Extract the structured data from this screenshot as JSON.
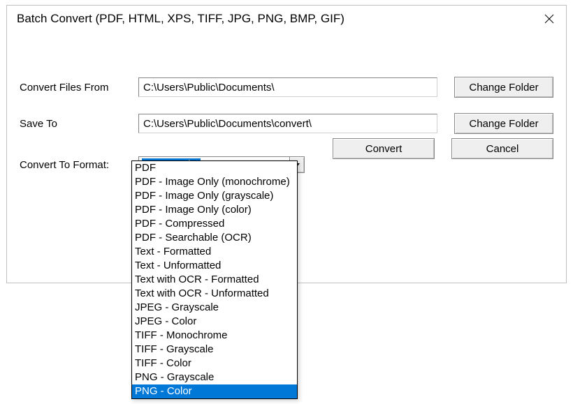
{
  "title": "Batch Convert (PDF, HTML, XPS, TIFF, JPG, PNG, BMP, GIF)",
  "labels": {
    "convert_from": "Convert Files From",
    "save_to": "Save To",
    "convert_format": "Convert To Format:"
  },
  "paths": {
    "from": "C:\\Users\\Public\\Documents\\",
    "to": "C:\\Users\\Public\\Documents\\convert\\"
  },
  "buttons": {
    "change_folder": "Change Folder",
    "convert": "Convert",
    "cancel": "Cancel"
  },
  "format": {
    "selected": "PNG - Color",
    "options": [
      "PDF",
      "PDF - Image Only (monochrome)",
      "PDF - Image Only (grayscale)",
      "PDF - Image Only (color)",
      "PDF - Compressed",
      "PDF - Searchable (OCR)",
      "Text - Formatted",
      "Text - Unformatted",
      "Text with OCR - Formatted",
      "Text with OCR - Unformatted",
      "JPEG - Grayscale",
      "JPEG - Color",
      "TIFF - Monochrome",
      "TIFF - Grayscale",
      "TIFF - Color",
      "PNG - Grayscale",
      "PNG - Color"
    ]
  }
}
